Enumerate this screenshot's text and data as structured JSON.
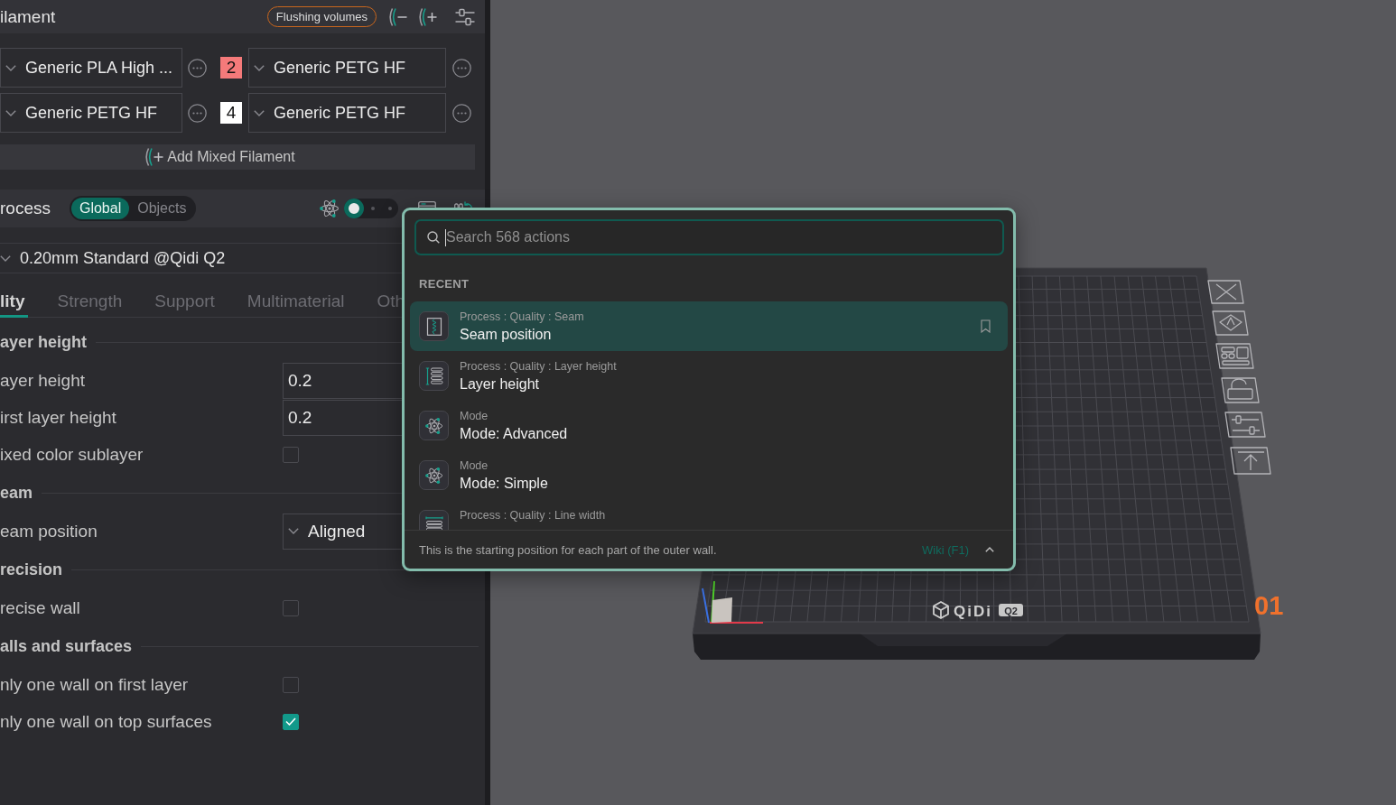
{
  "filament": {
    "title": "ilament",
    "flushing_button": "Flushing volumes",
    "rows": [
      {
        "left": {
          "name": "Generic PLA High ..."
        },
        "right": {
          "number": "2",
          "color": "#f57a7a",
          "name": "Generic PETG HF"
        }
      },
      {
        "left": {
          "name": "Generic PETG HF"
        },
        "right": {
          "number": "4",
          "color": "#ffffff",
          "name": "Generic PETG HF"
        }
      }
    ],
    "add_button": "Add Mixed Filament"
  },
  "process": {
    "title": "rocess",
    "scope": [
      {
        "label": "Global",
        "selected": true
      },
      {
        "label": "Objects",
        "selected": false
      }
    ],
    "mode_switch": [
      {
        "selected": true
      },
      {
        "selected": false
      },
      {
        "selected": false
      }
    ],
    "preset": "0.20mm Standard @Qidi Q2",
    "tabs": [
      {
        "label": "lity",
        "selected": true
      },
      {
        "label": "Strength",
        "selected": false
      },
      {
        "label": "Support",
        "selected": false
      },
      {
        "label": "Multimaterial",
        "selected": false
      },
      {
        "label": "Oth",
        "selected": false
      }
    ],
    "sections": [
      {
        "title": "ayer height",
        "rows": [
          {
            "kind": "input",
            "label": "ayer height",
            "value": "0.2"
          },
          {
            "kind": "input",
            "label": "irst layer height",
            "value": "0.2"
          },
          {
            "kind": "checkbox",
            "label": "ixed color sublayer",
            "checked": false
          }
        ]
      },
      {
        "title": "eam",
        "rows": [
          {
            "kind": "select",
            "label": "eam position",
            "value": "Aligned"
          }
        ]
      },
      {
        "title": "recision",
        "rows": [
          {
            "kind": "checkbox",
            "label": "recise wall",
            "checked": false
          }
        ]
      },
      {
        "title": "alls and surfaces",
        "rows": [
          {
            "kind": "checkbox",
            "label": "nly one wall on first layer",
            "checked": false
          },
          {
            "kind": "checkbox",
            "label": "nly one wall on top surfaces",
            "checked": true
          }
        ]
      }
    ]
  },
  "search_popup": {
    "placeholder": "Search 568 actions",
    "group": "RECENT",
    "items": [
      {
        "kind": "seam",
        "path": "Process : Quality : Seam",
        "title": "Seam position",
        "selected": true
      },
      {
        "kind": "layer_height",
        "path": "Process : Quality : Layer height",
        "title": "Layer height",
        "selected": false
      },
      {
        "kind": "mode",
        "path": "Mode",
        "title": "Mode: Advanced",
        "selected": false
      },
      {
        "kind": "mode",
        "path": "Mode",
        "title": "Mode: Simple",
        "selected": false
      },
      {
        "kind": "line_width",
        "path": "Process : Quality : Line width",
        "selected": false
      }
    ],
    "description": "This is the starting position for each part of the outer wall.",
    "wiki_link": "Wiki (F1)"
  },
  "plate": {
    "logo": "QiDi",
    "model": "Q2",
    "number": "01"
  }
}
